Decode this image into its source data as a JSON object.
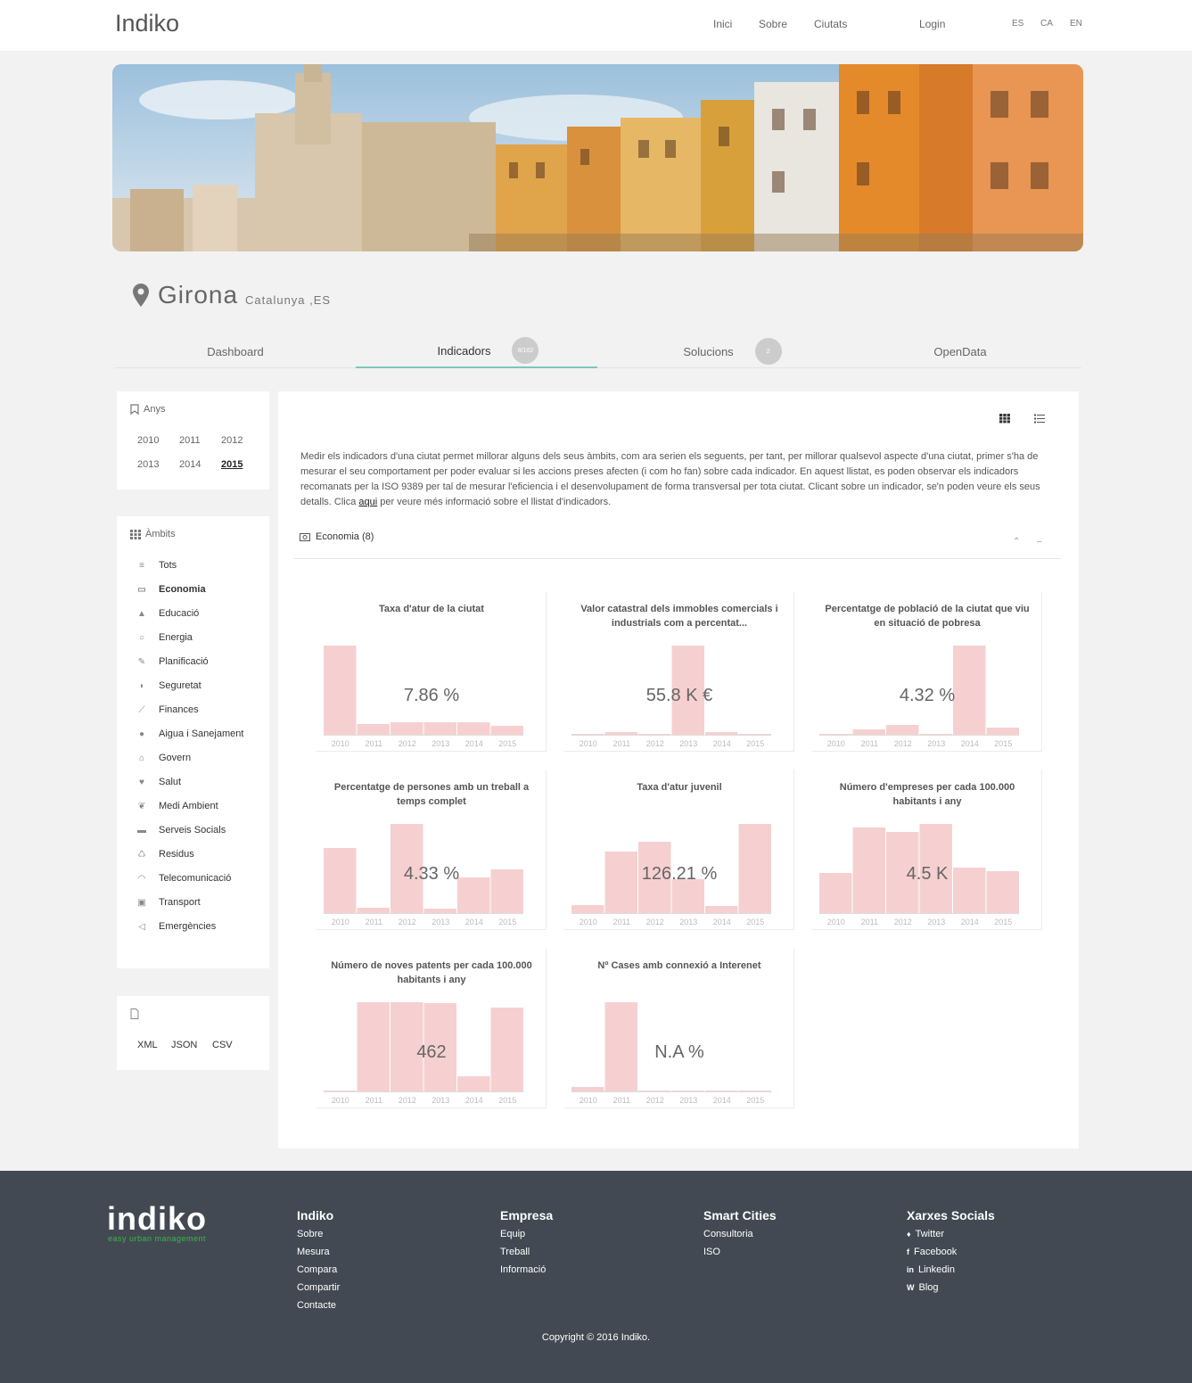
{
  "topbar": {
    "brand": "Indiko",
    "nav": [
      "Inici",
      "Sobre",
      "Ciutats"
    ],
    "login": "Login",
    "langs": [
      "ES",
      "CA",
      "EN"
    ]
  },
  "city": {
    "name": "Girona",
    "region": "Catalunya ,ES"
  },
  "tabs": [
    {
      "label": "Dashboard"
    },
    {
      "label": "Indicadors",
      "badge": "8/102"
    },
    {
      "label": "Solucions",
      "badge": "2"
    },
    {
      "label": "OpenData"
    }
  ],
  "years_box": {
    "title": "Anys",
    "years": [
      "2010",
      "2011",
      "2012",
      "2013",
      "2014",
      "2015"
    ],
    "selected": "2015"
  },
  "ambits_box": {
    "title": "Àmbits",
    "items": [
      {
        "label": "Tots",
        "icon": "bars-icon"
      },
      {
        "label": "Economia",
        "icon": "money-icon"
      },
      {
        "label": "Educació",
        "icon": "graduation-cap-icon"
      },
      {
        "label": "Energia",
        "icon": "lightbulb-icon"
      },
      {
        "label": "Planificació",
        "icon": "edit-icon"
      },
      {
        "label": "Seguretat",
        "icon": "shield-icon"
      },
      {
        "label": "Finances",
        "icon": "line-chart-icon"
      },
      {
        "label": "Aigua i Sanejament",
        "icon": "drop-icon"
      },
      {
        "label": "Govern",
        "icon": "institution-icon"
      },
      {
        "label": "Salut",
        "icon": "heartbeat-icon"
      },
      {
        "label": "Medi Ambient",
        "icon": "leaf-icon"
      },
      {
        "label": "Serveis Socials",
        "icon": "bed-icon"
      },
      {
        "label": "Residus",
        "icon": "recycle-icon"
      },
      {
        "label": "Telecomunicació",
        "icon": "wifi-icon"
      },
      {
        "label": "Transport",
        "icon": "car-icon"
      },
      {
        "label": "Emergències",
        "icon": "bullhorn-icon"
      }
    ],
    "selected": "Economia"
  },
  "export_box": {
    "icon": "file-icon",
    "formats": [
      "XML",
      "JSON",
      "CSV"
    ]
  },
  "main": {
    "intro_before": "Medir els indicadors d'una ciutat permet millorar alguns dels seus àmbits, com ara serien els seguents, per tant, per millorar qualsevol aspecte d'una ciutat, primer s'ha de mesurar el seu comportament per poder evaluar si les accions preses afecten (i com ho fan) sobre cada indicador. En aquest llistat, es poden observar els indicadors recomanats per la ISO 9389 per tal de mesurar l'eficiencia i el desenvolupament de forma transversal per tota ciutat. Clicant sobre un indicador, se'n poden veure els seus detalls. Clica ",
    "intro_link": "aqui",
    "intro_after": " per veure més informació sobre el llistat d'indicadors.",
    "section": "Economia (8)",
    "bar_color": "#f6d0d0",
    "indicators": [
      {
        "title": "Taxa d'atur de la ciutat",
        "value": "7.86 %"
      },
      {
        "title": "Valor catastral dels immobles comercials i industrials com a percentat...",
        "value": "55.8 K €"
      },
      {
        "title": "Percentatge de població de la ciutat que viu en situació de pobresa",
        "value": "4.32 %"
      },
      {
        "title": "Percentatge de persones amb un treball a temps complet",
        "value": "4.33 %"
      },
      {
        "title": "Taxa d'atur juvenil",
        "value": "126.21 %"
      },
      {
        "title": "Número d'empreses per cada 100.000 habitants i any",
        "value": "4.5 K"
      },
      {
        "title": "Número de noves patents per cada 100.000 habitants i any",
        "value": "462"
      },
      {
        "title": "Nº Cases amb connexió a Interenet",
        "value": "N.A %"
      }
    ]
  },
  "chart_data": [
    {
      "type": "bar",
      "categories": [
        "2010",
        "2011",
        "2012",
        "2013",
        "2014",
        "2015"
      ],
      "values": [
        100,
        12,
        14,
        14,
        14,
        10
      ],
      "ylim": [
        0,
        100
      ]
    },
    {
      "type": "bar",
      "categories": [
        "2010",
        "2011",
        "2012",
        "2013",
        "2014",
        "2015"
      ],
      "values": [
        1,
        3,
        1,
        100,
        3,
        1
      ],
      "ylim": [
        0,
        100
      ]
    },
    {
      "type": "bar",
      "categories": [
        "2010",
        "2011",
        "2012",
        "2013",
        "2014",
        "2015"
      ],
      "values": [
        1,
        6,
        11,
        1,
        100,
        8
      ],
      "ylim": [
        0,
        100
      ]
    },
    {
      "type": "bar",
      "categories": [
        "2010",
        "2011",
        "2012",
        "2013",
        "2014",
        "2015"
      ],
      "values": [
        73,
        6,
        100,
        5,
        40,
        49
      ],
      "ylim": [
        0,
        100
      ]
    },
    {
      "type": "bar",
      "categories": [
        "2010",
        "2011",
        "2012",
        "2013",
        "2014",
        "2015"
      ],
      "values": [
        9,
        69,
        80,
        38,
        8,
        100
      ],
      "ylim": [
        0,
        100
      ]
    },
    {
      "type": "bar",
      "categories": [
        "2010",
        "2011",
        "2012",
        "2013",
        "2014",
        "2015"
      ],
      "values": [
        45,
        96,
        91,
        100,
        51,
        47
      ],
      "ylim": [
        0,
        100
      ]
    },
    {
      "type": "bar",
      "categories": [
        "2010",
        "2011",
        "2012",
        "2013",
        "2014",
        "2015"
      ],
      "values": [
        1,
        100,
        100,
        99,
        17,
        94
      ],
      "ylim": [
        0,
        100
      ]
    },
    {
      "type": "bar",
      "categories": [
        "2010",
        "2011",
        "2012",
        "2013",
        "2014",
        "2015"
      ],
      "values": [
        5,
        100,
        0,
        0,
        0,
        0
      ],
      "ylim": [
        0,
        100
      ]
    }
  ],
  "footer": {
    "logo": "indiko",
    "tagline": "easy urban management",
    "columns": [
      {
        "head": "Indiko",
        "links": [
          "Sobre",
          "Mesura",
          "Compara",
          "Compartir",
          "Contacte"
        ]
      },
      {
        "head": "Empresa",
        "links": [
          "Equip",
          "Treball",
          "Informació"
        ]
      },
      {
        "head": "Smart Cities",
        "links": [
          "Consultoria",
          "ISO"
        ]
      },
      {
        "head": "Xarxes Socials",
        "links": [
          "Twitter",
          "Facebook",
          "Linkedin",
          "Blog"
        ]
      }
    ],
    "copyright": "Copyright © 2016 Indiko."
  }
}
